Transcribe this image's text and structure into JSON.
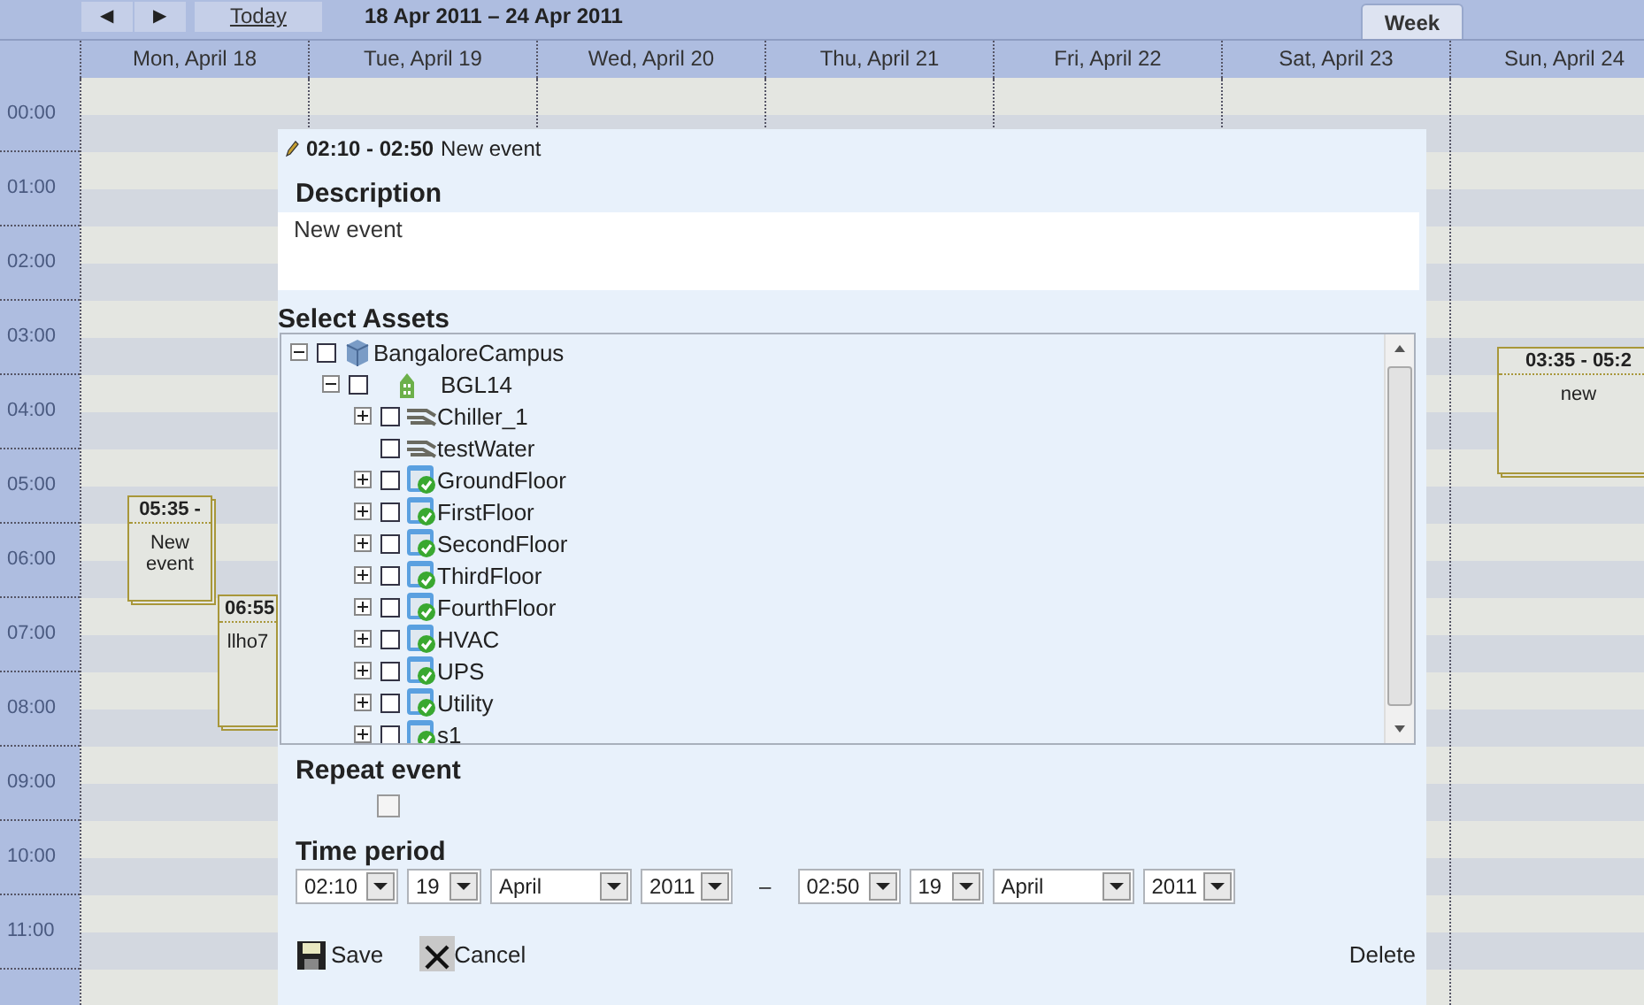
{
  "toolbar": {
    "prev": "◀",
    "next": "▶",
    "today": "Today",
    "range": "18 Apr 2011 – 24 Apr 2011",
    "views": [
      {
        "label": "Week",
        "selected": true
      }
    ]
  },
  "days": [
    "Mon, April 18",
    "Tue, April 19",
    "Wed, April 20",
    "Thu, April 21",
    "Fri, April 22",
    "Sat, April 23",
    "Sun, April 24"
  ],
  "hours": [
    "00:00",
    "01:00",
    "02:00",
    "03:00",
    "04:00",
    "05:00",
    "06:00",
    "07:00",
    "08:00",
    "09:00",
    "10:00",
    "11:00"
  ],
  "events": [
    {
      "time": "05:35 -",
      "title": "New event"
    },
    {
      "time": "06:55",
      "title": "llho7"
    },
    {
      "time": "03:35 - 05:2",
      "title": "new"
    }
  ],
  "dialog": {
    "time": "02:10 - 02:50",
    "title": "New event",
    "description_heading": "Description",
    "description": "New event",
    "assets_heading": "Select Assets",
    "tree": [
      {
        "label": "BangaloreCampus",
        "kind": "campus",
        "checked": false,
        "expandable": true,
        "expanded": true,
        "children": [
          {
            "label": "BGL14",
            "kind": "building",
            "checked": false,
            "expandable": true,
            "expanded": true,
            "children": [
              {
                "label": "Chiller_1",
                "kind": "equipment",
                "checked": false,
                "expandable": true,
                "expanded": false
              },
              {
                "label": "testWater",
                "kind": "equipment",
                "checked": false,
                "expandable": false
              },
              {
                "label": "GroundFloor",
                "kind": "area",
                "checked": false,
                "expandable": true,
                "expanded": false
              },
              {
                "label": "FirstFloor",
                "kind": "area",
                "checked": false,
                "expandable": true,
                "expanded": false
              },
              {
                "label": "SecondFloor",
                "kind": "area",
                "checked": false,
                "expandable": true,
                "expanded": false
              },
              {
                "label": "ThirdFloor",
                "kind": "area",
                "checked": false,
                "expandable": true,
                "expanded": false
              },
              {
                "label": "FourthFloor",
                "kind": "area",
                "checked": false,
                "expandable": true,
                "expanded": false
              },
              {
                "label": "HVAC",
                "kind": "area",
                "checked": false,
                "expandable": true,
                "expanded": false
              },
              {
                "label": "UPS",
                "kind": "area",
                "checked": false,
                "expandable": true,
                "expanded": false
              },
              {
                "label": "Utility",
                "kind": "area",
                "checked": false,
                "expandable": true,
                "expanded": false
              },
              {
                "label": "s1",
                "kind": "area",
                "checked": false,
                "expandable": true,
                "expanded": false
              }
            ]
          }
        ]
      }
    ],
    "repeat": {
      "label": "Repeat event",
      "checked": false
    },
    "period_heading": "Time period",
    "start": [
      {
        "kind": "time",
        "value": "02:10"
      },
      {
        "kind": "day",
        "value": "19"
      },
      {
        "kind": "month",
        "value": "April"
      },
      {
        "kind": "year",
        "value": "2011"
      }
    ],
    "separator": "–",
    "end": [
      {
        "kind": "time",
        "value": "02:50"
      },
      {
        "kind": "day",
        "value": "19"
      },
      {
        "kind": "month",
        "value": "April"
      },
      {
        "kind": "year",
        "value": "2011"
      }
    ],
    "save": "Save",
    "cancel": "Cancel",
    "delete": "Delete"
  }
}
